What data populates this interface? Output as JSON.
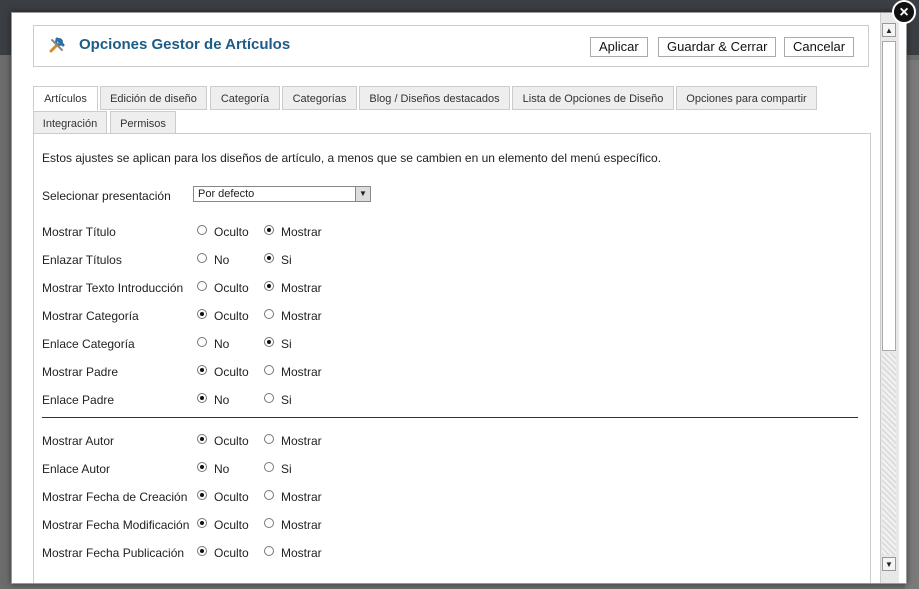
{
  "header": {
    "title": "Opciones Gestor de Artículos",
    "buttons": {
      "apply": "Aplicar",
      "save_close": "Guardar & Cerrar",
      "cancel": "Cancelar"
    }
  },
  "tabs": [
    "Artículos",
    "Edición de diseño",
    "Categoría",
    "Categorías",
    "Blog / Diseños destacados",
    "Lista de Opciones de Diseño",
    "Opciones para compartir",
    "Integración",
    "Permisos"
  ],
  "intro": "Estos ajustes se aplican para los diseños de artículo, a menos que se cambien en un elemento del menú específico.",
  "layout_select": {
    "label": "Selecionar presentación",
    "value": "Por defecto"
  },
  "options": [
    {
      "label": "Mostrar Título",
      "opt1": "Oculto",
      "opt2": "Mostrar",
      "selected": 2
    },
    {
      "label": "Enlazar Títulos",
      "opt1": "No",
      "opt2": "Si",
      "selected": 2
    },
    {
      "label": "Mostrar Texto Introducción",
      "opt1": "Oculto",
      "opt2": "Mostrar",
      "selected": 2
    },
    {
      "label": "Mostrar Categoría",
      "opt1": "Oculto",
      "opt2": "Mostrar",
      "selected": 1
    },
    {
      "label": "Enlace Categoría",
      "opt1": "No",
      "opt2": "Si",
      "selected": 2
    },
    {
      "label": "Mostrar Padre",
      "opt1": "Oculto",
      "opt2": "Mostrar",
      "selected": 1
    },
    {
      "label": "Enlace Padre",
      "opt1": "No",
      "opt2": "Si",
      "selected": 1
    },
    {
      "label": "Mostrar Autor",
      "opt1": "Oculto",
      "opt2": "Mostrar",
      "selected": 1
    },
    {
      "label": "Enlace Autor",
      "opt1": "No",
      "opt2": "Si",
      "selected": 1
    },
    {
      "label": "Mostrar Fecha de Creación",
      "opt1": "Oculto",
      "opt2": "Mostrar",
      "selected": 1
    },
    {
      "label": "Mostrar Fecha Modificación",
      "opt1": "Oculto",
      "opt2": "Mostrar",
      "selected": 1
    },
    {
      "label": "Mostrar Fecha Publicación",
      "opt1": "Oculto",
      "opt2": "Mostrar",
      "selected": 1
    }
  ],
  "icons": {
    "header": "tools-icon",
    "close": "close-icon"
  },
  "colors": {
    "title": "#1d5c87"
  }
}
